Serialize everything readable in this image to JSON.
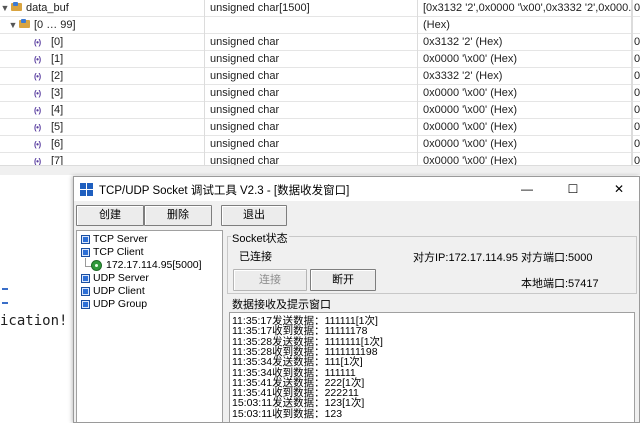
{
  "watch": {
    "rows": [
      {
        "name": "data_buf",
        "type": "unsigned char[1500]",
        "value": "[0x3132 '2',0x0000 '\\x00',0x3332 '2',0x000...",
        "extra": "0",
        "level": 0,
        "expander": "▼",
        "icon": "struct-icon"
      },
      {
        "name": "[0 … 99]",
        "type": "",
        "value": "(Hex)",
        "extra": "",
        "level": 1,
        "expander": "▼",
        "icon": "struct-icon"
      },
      {
        "name": "[0]",
        "type": "unsigned char",
        "value": "0x3132 '2' (Hex)",
        "extra": "0",
        "level": 2,
        "expander": "",
        "icon": "field-icon"
      },
      {
        "name": "[1]",
        "type": "unsigned char",
        "value": "0x0000 '\\x00' (Hex)",
        "extra": "0",
        "level": 2,
        "expander": "",
        "icon": "field-icon"
      },
      {
        "name": "[2]",
        "type": "unsigned char",
        "value": "0x3332 '2' (Hex)",
        "extra": "0",
        "level": 2,
        "expander": "",
        "icon": "field-icon"
      },
      {
        "name": "[3]",
        "type": "unsigned char",
        "value": "0x0000 '\\x00' (Hex)",
        "extra": "0",
        "level": 2,
        "expander": "",
        "icon": "field-icon"
      },
      {
        "name": "[4]",
        "type": "unsigned char",
        "value": "0x0000 '\\x00' (Hex)",
        "extra": "0",
        "level": 2,
        "expander": "",
        "icon": "field-icon"
      },
      {
        "name": "[5]",
        "type": "unsigned char",
        "value": "0x0000 '\\x00' (Hex)",
        "extra": "0",
        "level": 2,
        "expander": "",
        "icon": "field-icon"
      },
      {
        "name": "[6]",
        "type": "unsigned char",
        "value": "0x0000 '\\x00' (Hex)",
        "extra": "0",
        "level": 2,
        "expander": "",
        "icon": "field-icon"
      },
      {
        "name": "[7]",
        "type": "unsigned char",
        "value": "0x0000 '\\x00' (Hex)",
        "extra": "0",
        "level": 2,
        "expander": "",
        "icon": "field-icon"
      }
    ],
    "field_icon_glyph": "(•)"
  },
  "editor": {
    "visible_text": "ication!"
  },
  "window": {
    "title": "TCP/UDP Socket 调试工具 V2.3  - [数据收发窗口]",
    "controls": {
      "minimize": "—",
      "maximize": "☐",
      "close": "✕"
    },
    "toolbar": {
      "create": "创建",
      "delete": "删除",
      "exit": "退出"
    },
    "tree": {
      "tcp_server": "TCP Server",
      "tcp_client": "TCP Client",
      "connection": "172.17.114.95[5000]",
      "udp_server": "UDP Server",
      "udp_client": "UDP Client",
      "udp_group": "UDP Group"
    },
    "socket_status": {
      "group_label": "Socket状态",
      "state": "已连接",
      "peer_ip": "对方IP:172.17.114.95",
      "peer_port": "对方端口:5000",
      "local_port": "本地端口:57417",
      "connect_button": "连接",
      "disconnect_button": "断开"
    },
    "log": {
      "group_label": "数据接收及提示窗口",
      "lines": [
        "11:35:17发送数据：111111[1次]",
        "11:35:17收到数据：11111178",
        "11:35:28发送数据：1111111[1次]",
        "11:35:28收到数据：1111111198",
        "11:35:34发送数据：111[1次]",
        "11:35:34收到数据：111111",
        "11:35:41发送数据：222[1次]",
        "11:35:41收到数据：222211",
        "15:03:11发送数据：123[1次]",
        "15:03:11收到数据：123"
      ]
    }
  },
  "colors": {
    "window_bg": "#f0f0f0",
    "icon_blue": "#1f5fbf",
    "icon_green": "#2f9a3a",
    "field_icon": "#5a3fa0"
  }
}
